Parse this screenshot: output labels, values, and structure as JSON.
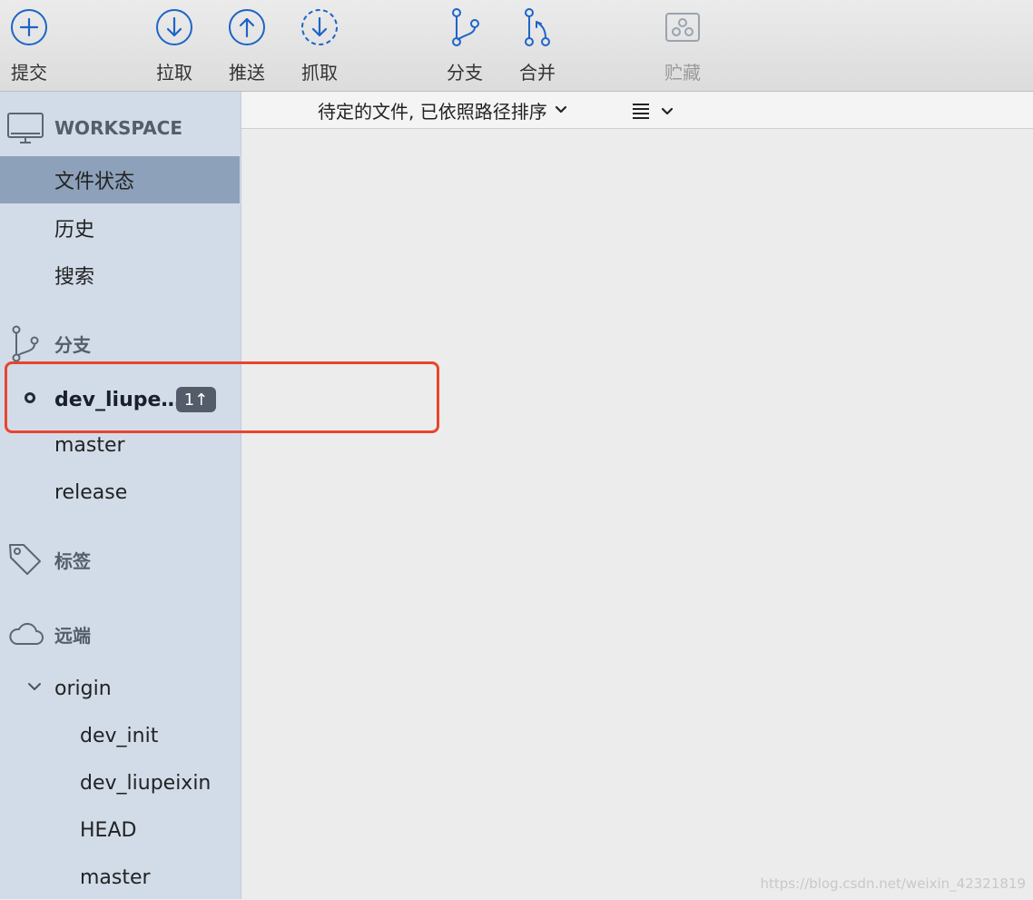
{
  "toolbar": {
    "commit": "提交",
    "pull": "拉取",
    "push": "推送",
    "fetch": "抓取",
    "branch": "分支",
    "merge": "合并",
    "stash": "贮藏"
  },
  "sidebar": {
    "workspace": {
      "header": "WORKSPACE",
      "items": [
        "文件状态",
        "历史",
        "搜索"
      ],
      "selected": "文件状态"
    },
    "branches": {
      "header": "分支",
      "current": "dev_liupe…",
      "current_badge": "1↑",
      "items": [
        "master",
        "release"
      ]
    },
    "tags": {
      "header": "标签"
    },
    "remotes": {
      "header": "远端",
      "origin": "origin",
      "items": [
        "dev_init",
        "dev_liupeixin",
        "HEAD",
        "master"
      ]
    }
  },
  "main": {
    "sort_label": "待定的文件, 已依照路径排序"
  },
  "watermark": "https://blog.csdn.net/weixin_42321819",
  "colors": {
    "accent": "#1d64c8",
    "sidebar_bg": "#d2dce8",
    "selected_bg": "#8ea1bb",
    "highlight": "#e8452e"
  }
}
